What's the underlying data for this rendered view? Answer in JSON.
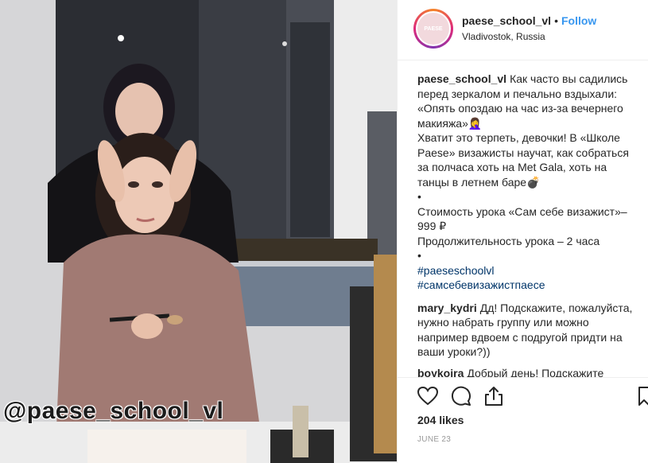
{
  "post": {
    "watermark": "@paese_school_vl"
  },
  "header": {
    "username": "paese_school_vl",
    "separator": "•",
    "follow_label": "Follow",
    "location": "Vladivostok, Russia",
    "avatar_text": "PAESE"
  },
  "caption": {
    "username": "paese_school_vl",
    "line1": "Как часто вы садились перед зеркалом и печально вздыхали: «Опять опоздаю на час из-за вечернего макияжа»🤦‍♀️",
    "line2": "Хватит это терпеть, девочки! В «Школе Paese» визажисты научат, как собраться за полчаса хоть на Met Gala, хоть на танцы в летнем баре💣",
    "bullet1": "•",
    "price": "Стоимость урока «Сам себе визажист»– 999 ₽",
    "duration": "Продолжительность урока – 2 часа",
    "bullet2": "•",
    "hashtag1": "#paeseschoolvl",
    "hashtag2": "#самсебевизажистпаесе"
  },
  "comments": [
    {
      "username": "mary_kydri",
      "text": "Дд! Подскажите, пожалуйста, нужно набрать группу или можно например вдвоем с подругой придти на ваши уроки?))"
    },
    {
      "username": "boykoira",
      "text": "Добрый день! Подскажите"
    }
  ],
  "actions": {
    "icons": [
      "heart-icon",
      "comment-icon",
      "share-icon",
      "bookmark-icon"
    ]
  },
  "likes": "204 likes",
  "date": "JUNE 23",
  "colors": {
    "link": "#3897f0",
    "hashtag": "#003569",
    "muted": "#999999",
    "border": "#efefef"
  }
}
